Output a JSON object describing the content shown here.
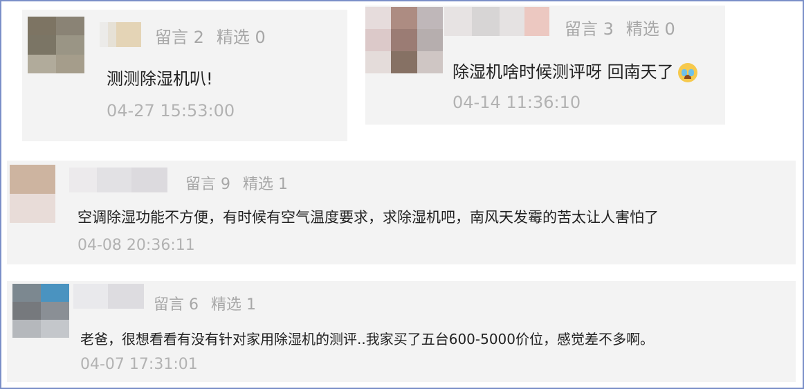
{
  "comments": [
    {
      "likes_label": "留言 2",
      "featured_label": "精选 0",
      "text": "测测除湿机叭!",
      "time": "04-27 15:53:00"
    },
    {
      "likes_label": "留言 3",
      "featured_label": "精选 0",
      "text": "除湿机啥时候测评呀 回南天了",
      "emoji": "crying-face-emoji",
      "time": "04-14 11:36:10"
    },
    {
      "likes_label": "留言 9",
      "featured_label": "精选 1",
      "text": "空调除湿功能不方便，有时候有空气温度要求，求除湿机吧，南风天发霉的苦太让人害怕了",
      "time": "04-08 20:36:11"
    },
    {
      "likes_label": "留言 6",
      "featured_label": "精选 1",
      "text": "老爸，很想看看有没有针对家用除湿机的测评..我家买了五台600-5000价位，感觉差不多啊。",
      "time": "04-07 17:31:01"
    }
  ],
  "colors": {
    "frame_border": "#7a8fc8",
    "meta_text": "#a7a7a7",
    "body_text": "#222222",
    "time_text": "#b2b2b2",
    "panel_bg": "#f3f3f3"
  }
}
